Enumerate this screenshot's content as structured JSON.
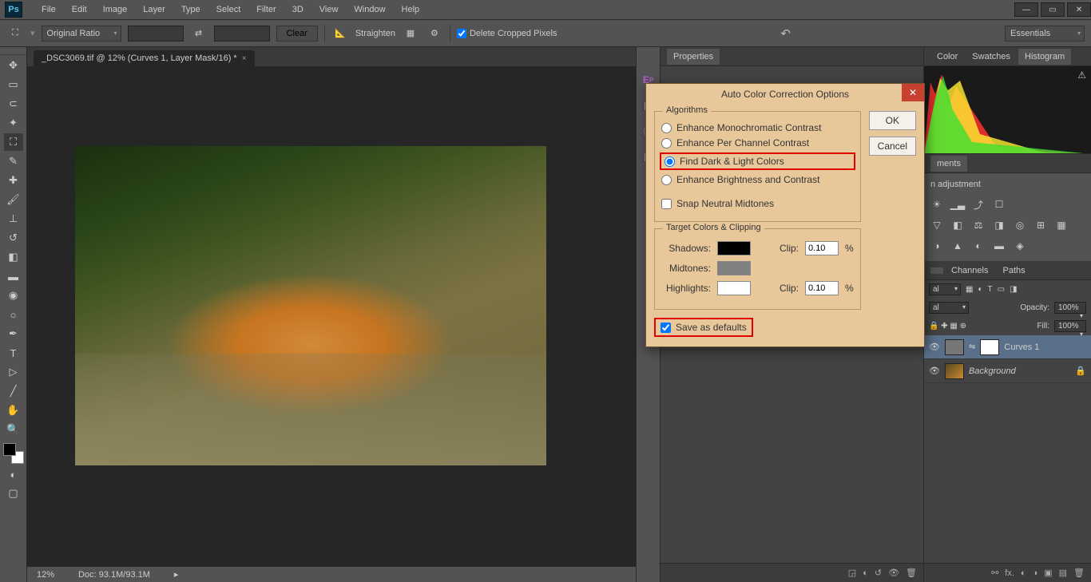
{
  "app": {
    "logo": "Ps"
  },
  "menu": [
    "File",
    "Edit",
    "Image",
    "Layer",
    "Type",
    "Select",
    "Filter",
    "3D",
    "View",
    "Window",
    "Help"
  ],
  "options": {
    "ratio": "Original Ratio",
    "clear": "Clear",
    "straighten": "Straighten",
    "deleteCropped": "Delete Cropped Pixels",
    "workspace": "Essentials"
  },
  "doc": {
    "tab": "_DSC3069.tif @ 12% (Curves 1, Layer Mask/16) *",
    "zoom": "12%",
    "info": "Doc: 93.1M/93.1M"
  },
  "rightTabs": {
    "properties": "Properties",
    "color": "Color",
    "swatches": "Swatches",
    "histogram": "Histogram",
    "adjustments": "ments",
    "adjustmentsHint": "n adjustment",
    "layers": "",
    "channels": "Channels",
    "paths": "Paths"
  },
  "layers": {
    "blend": "al",
    "opacityLabel": "Opacity:",
    "opacity": "100%",
    "fillLabel": "Fill:",
    "fill": "100%",
    "items": [
      {
        "name": "Curves 1",
        "active": true,
        "locked": false,
        "mask": true
      },
      {
        "name": "Background",
        "active": false,
        "locked": true,
        "mask": false
      }
    ]
  },
  "dialog": {
    "title": "Auto Color Correction Options",
    "ok": "OK",
    "cancel": "Cancel",
    "algorithmsLegend": "Algorithms",
    "algos": [
      "Enhance Monochromatic Contrast",
      "Enhance Per Channel Contrast",
      "Find Dark & Light Colors",
      "Enhance Brightness and Contrast"
    ],
    "selectedAlgo": 2,
    "snap": "Snap Neutral Midtones",
    "targetsLegend": "Target Colors & Clipping",
    "shadowsLabel": "Shadows:",
    "midtonesLabel": "Midtones:",
    "highlightsLabel": "Highlights:",
    "clipLabel": "Clip:",
    "clipShadows": "0.10",
    "clipHighlights": "0.10",
    "pct": "%",
    "shadowsColor": "#000000",
    "midtonesColor": "#808080",
    "highlightsColor": "#ffffff",
    "saveDefaults": "Save as defaults"
  },
  "tools": [
    "move",
    "marquee",
    "lasso",
    "wand",
    "crop",
    "eyedropper",
    "heal",
    "brush",
    "stamp",
    "history",
    "eraser",
    "gradient",
    "blur",
    "dodge",
    "pen",
    "type",
    "path",
    "line",
    "hand",
    "zoom"
  ]
}
